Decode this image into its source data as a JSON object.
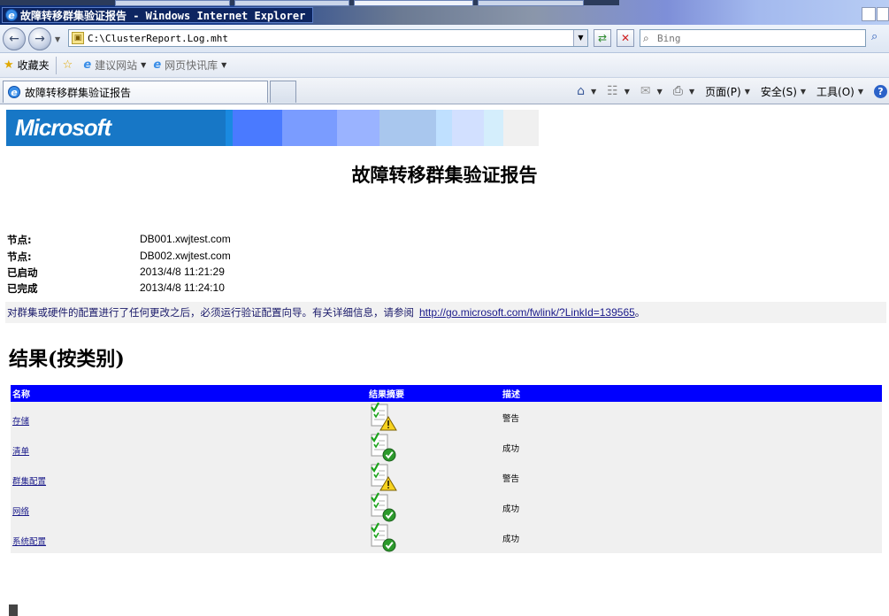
{
  "window": {
    "title": "故障转移群集验证报告 - Windows Internet Explorer"
  },
  "navigation": {
    "address": "C:\\ClusterReport.Log.mht",
    "search_placeholder": "Bing"
  },
  "favorites": {
    "favorites_label": "收藏夹",
    "items": [
      {
        "label": "建议网站"
      },
      {
        "label": "网页快讯库"
      }
    ]
  },
  "tabs": [
    {
      "label": "故障转移群集验证报告"
    }
  ],
  "commands": {
    "page": "页面(P)",
    "safety": "安全(S)",
    "tools": "工具(O)"
  },
  "report": {
    "logo_text": "Microsoft",
    "title": "故障转移群集验证报告",
    "info": [
      {
        "key": "节点:",
        "value": "DB001.xwjtest.com"
      },
      {
        "key": "节点:",
        "value": "DB002.xwjtest.com"
      },
      {
        "key": "已启动",
        "value": "2013/4/8 11:21:29"
      },
      {
        "key": "已完成",
        "value": "2013/4/8 11:24:10"
      }
    ],
    "notice_text": "对群集或硬件的配置进行了任何更改之后，必须运行验证配置向导。有关详细信息，请参阅",
    "notice_link": "http://go.microsoft.com/fwlink/?LinkId=139565",
    "notice_end": "。",
    "section_title": "结果(按类别)",
    "table": {
      "headers": [
        "名称",
        "结果摘要",
        "描述"
      ],
      "rows": [
        {
          "name": "存储",
          "status": "warning",
          "description": "警告"
        },
        {
          "name": "清单",
          "status": "success",
          "description": "成功"
        },
        {
          "name": "群集配置",
          "status": "warning",
          "description": "警告"
        },
        {
          "name": "网络",
          "status": "success",
          "description": "成功"
        },
        {
          "name": "系统配置",
          "status": "success",
          "description": "成功"
        }
      ]
    }
  },
  "colors": {
    "table_header": "#0000ff",
    "banner_blue": "#1777c6",
    "link": "#1a1a8a"
  }
}
